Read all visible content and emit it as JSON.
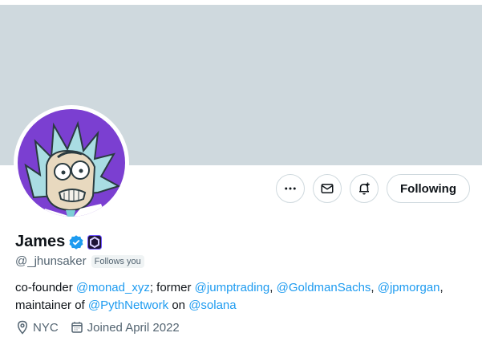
{
  "profile": {
    "name": "James",
    "handle": "@_jhunsaker",
    "follows_you": "Follows you",
    "bio": {
      "t1": "co-founder ",
      "m1": "@monad_xyz",
      "t2": "; former ",
      "m2": "@jumptrading",
      "t3": ", ",
      "m3": "@GoldmanSachs",
      "t4": ", ",
      "m4": "@jpmorgan",
      "t5": ",",
      "t6": "maintainer of ",
      "m5": "@PythNetwork",
      "t7": " on ",
      "m6": "@solana"
    },
    "location": "NYC",
    "joined": "Joined April 2022"
  },
  "actions": {
    "following_label": "Following"
  },
  "colors": {
    "banner": "#cfd9de",
    "accent": "#1d9bf0",
    "avatar_bg": "#7b3fd1",
    "secondary_text": "#536471"
  },
  "icons": {
    "more": "more-icon",
    "message": "envelope-icon",
    "notify": "bell-plus-icon",
    "verified": "verified-badge-icon",
    "affiliate": "affiliate-badge-icon",
    "location": "location-icon",
    "calendar": "calendar-icon"
  }
}
